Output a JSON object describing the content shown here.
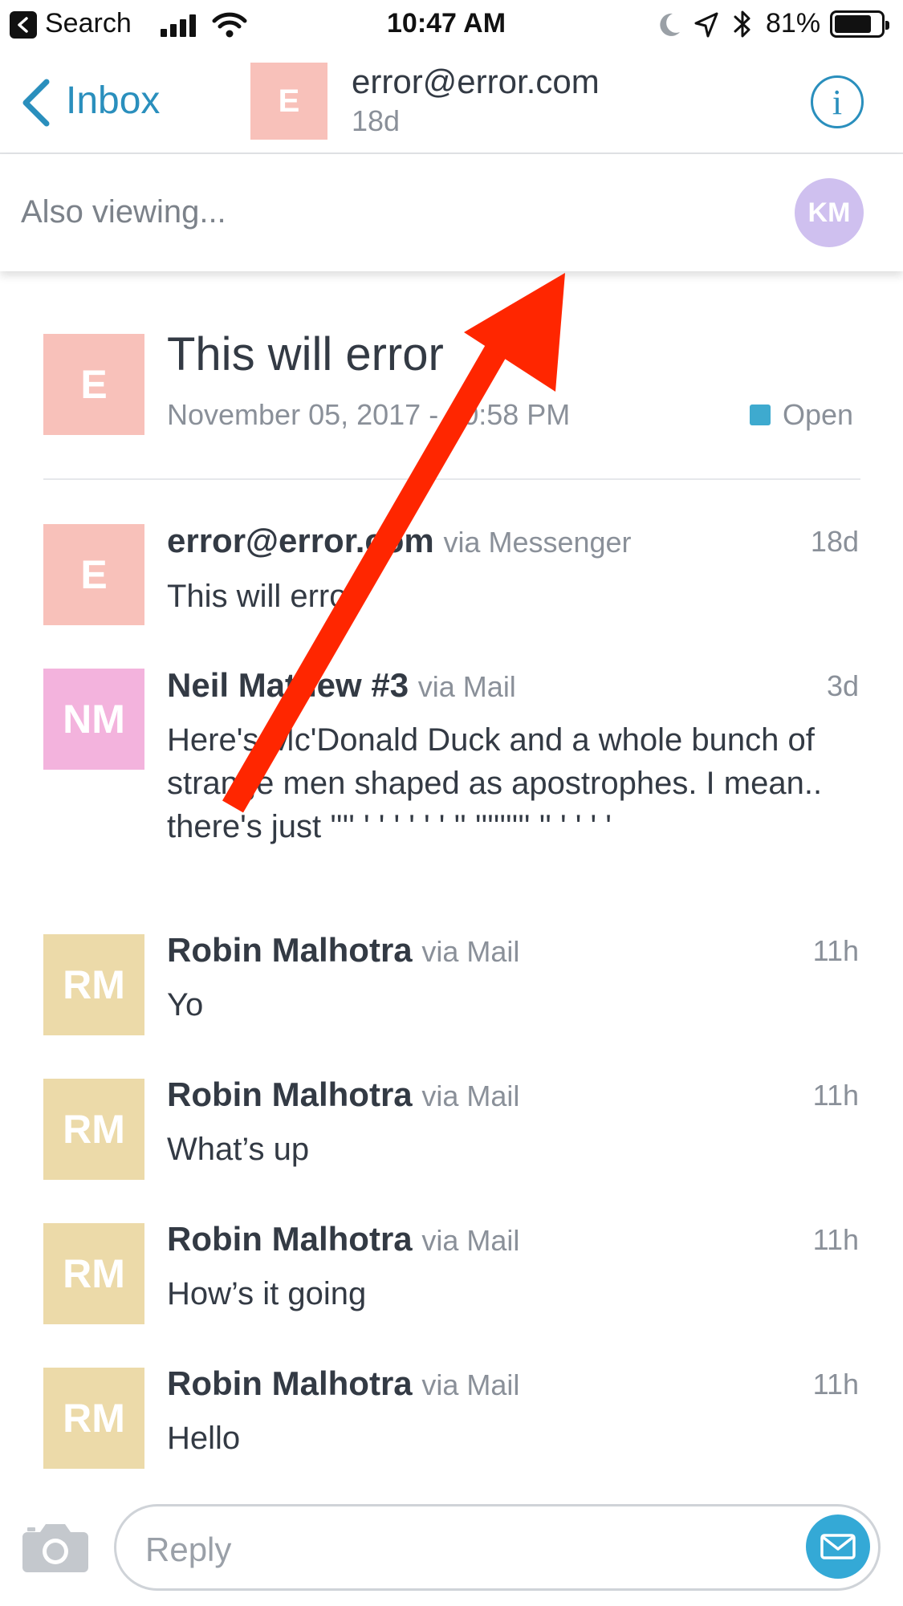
{
  "status_bar": {
    "back_app": "Search",
    "time": "10:47 AM",
    "battery": "81%",
    "battery_level": 0.81
  },
  "nav": {
    "back_label": "Inbox",
    "avatar_letter": "E",
    "title": "error@error.com",
    "subtitle": "18d",
    "info_icon": "info-icon"
  },
  "also_viewing": {
    "label": "Also viewing...",
    "viewer_initials": "KM"
  },
  "conversation": {
    "avatar_letter": "E",
    "title": "This will error",
    "date": "November 05, 2017 - 10:58 PM",
    "status": "Open"
  },
  "messages": [
    {
      "initials": "E",
      "name": "error@error.com",
      "via": "via Messenger",
      "time": "18d",
      "body": "This will error"
    },
    {
      "initials": "NM",
      "name": "Neil Mathew #3",
      "via": "via Mail",
      "time": "3d",
      "body": "Here's Mc'Donald Duck and a whole bunch of strange men shaped as apostrophes. I mean.. there's just '''' ' ' ' ' ' ' '' ''''''''' '' ' ' ' '"
    },
    {
      "initials": "RM",
      "name": "Robin Malhotra",
      "via": "via Mail",
      "time": "11h",
      "body": "Yo"
    },
    {
      "initials": "RM",
      "name": "Robin Malhotra",
      "via": "via Mail",
      "time": "11h",
      "body": "What’s up"
    },
    {
      "initials": "RM",
      "name": "Robin Malhotra",
      "via": "via Mail",
      "time": "11h",
      "body": "How’s it going"
    },
    {
      "initials": "RM",
      "name": "Robin Malhotra",
      "via": "via Mail",
      "time": "11h",
      "body": "Hello"
    }
  ],
  "reply": {
    "placeholder": "Reply"
  },
  "colors": {
    "accent": "#2a8fbd",
    "avatar_e": "#f8c1ba",
    "avatar_nm": "#f3b3dd",
    "avatar_rm": "#ecdaa9",
    "avatar_km": "#cfc0ef",
    "status_open": "#3eaacf",
    "annotation_arrow": "#ff2600"
  }
}
